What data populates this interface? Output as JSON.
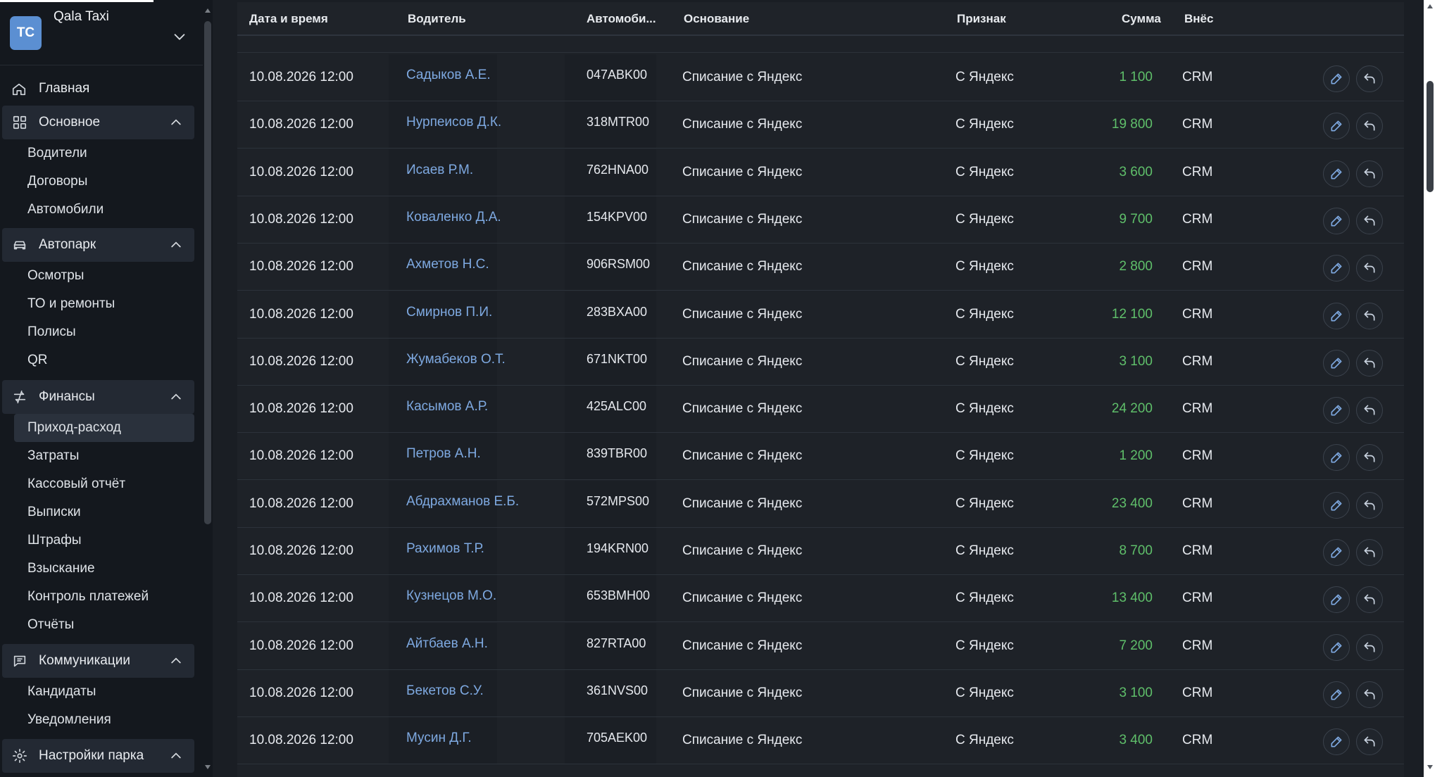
{
  "workspace": {
    "avatar_initials": "TC",
    "name": "Qala Taxi"
  },
  "nav": {
    "home": "Главная",
    "sections": [
      {
        "label": "Основное",
        "items": [
          "Водители",
          "Договоры",
          "Автомобили"
        ]
      },
      {
        "label": "Автопарк",
        "items": [
          "Осмотры",
          "ТО и ремонты",
          "Полисы",
          "QR"
        ]
      },
      {
        "label": "Финансы",
        "items": [
          "Приход-расход",
          "Затраты",
          "Кассовый отчёт",
          "Выписки",
          "Штрафы",
          "Взыскание",
          "Контроль платежей",
          "Отчёты"
        ],
        "active": "Приход-расход"
      },
      {
        "label": "Коммуникации",
        "items": [
          "Кандидаты",
          "Уведомления"
        ]
      },
      {
        "label": "Настройки парка",
        "items": []
      }
    ]
  },
  "table": {
    "columns": [
      "Дата и время",
      "Водитель",
      "Автомоби...",
      "Основание",
      "Признак",
      "Сумма",
      "Внёс"
    ],
    "rows": [
      {
        "datetime": "10.08.2026 12:00",
        "driver": "Садыков А.Е.",
        "car": "047ABK00",
        "reason": "Списание с Яндекс",
        "sign": "С Яндекс",
        "amount": "1 100",
        "by": "CRM"
      },
      {
        "datetime": "10.08.2026 12:00",
        "driver": "Нурпеисов Д.К.",
        "car": "318MTR00",
        "reason": "Списание с Яндекс",
        "sign": "С Яндекс",
        "amount": "19 800",
        "by": "CRM"
      },
      {
        "datetime": "10.08.2026 12:00",
        "driver": "Исаев Р.М.",
        "car": "762HNA00",
        "reason": "Списание с Яндекс",
        "sign": "С Яндекс",
        "amount": "3 600",
        "by": "CRM"
      },
      {
        "datetime": "10.08.2026 12:00",
        "driver": "Коваленко Д.А.",
        "car": "154KPV00",
        "reason": "Списание с Яндекс",
        "sign": "С Яндекс",
        "amount": "9 700",
        "by": "CRM"
      },
      {
        "datetime": "10.08.2026 12:00",
        "driver": "Ахметов Н.С.",
        "car": "906RSM00",
        "reason": "Списание с Яндекс",
        "sign": "С Яндекс",
        "amount": "2 800",
        "by": "CRM"
      },
      {
        "datetime": "10.08.2026 12:00",
        "driver": "Смирнов П.И.",
        "car": "283BXA00",
        "reason": "Списание с Яндекс",
        "sign": "С Яндекс",
        "amount": "12 100",
        "by": "CRM"
      },
      {
        "datetime": "10.08.2026 12:00",
        "driver": "Жумабеков О.Т.",
        "car": "671NKT00",
        "reason": "Списание с Яндекс",
        "sign": "С Яндекс",
        "amount": "3 100",
        "by": "CRM"
      },
      {
        "datetime": "10.08.2026 12:00",
        "driver": "Касымов А.Р.",
        "car": "425ALC00",
        "reason": "Списание с Яндекс",
        "sign": "С Яндекс",
        "amount": "24 200",
        "by": "CRM"
      },
      {
        "datetime": "10.08.2026 12:00",
        "driver": "Петров А.Н.",
        "car": "839TBR00",
        "reason": "Списание с Яндекс",
        "sign": "С Яндекс",
        "amount": "1 200",
        "by": "CRM"
      },
      {
        "datetime": "10.08.2026 12:00",
        "driver": "Абдрахманов Е.Б.",
        "car": "572MPS00",
        "reason": "Списание с Яндекс",
        "sign": "С Яндекс",
        "amount": "23 400",
        "by": "CRM"
      },
      {
        "datetime": "10.08.2026 12:00",
        "driver": "Рахимов Т.Р.",
        "car": "194KRN00",
        "reason": "Списание с Яндекс",
        "sign": "С Яндекс",
        "amount": "8 700",
        "by": "CRM"
      },
      {
        "datetime": "10.08.2026 12:00",
        "driver": "Кузнецов М.О.",
        "car": "653BMH00",
        "reason": "Списание с Яндекс",
        "sign": "С Яндекс",
        "amount": "13 400",
        "by": "CRM"
      },
      {
        "datetime": "10.08.2026 12:00",
        "driver": "Айтбаев А.Н.",
        "car": "827RTA00",
        "reason": "Списание с Яндекс",
        "sign": "С Яндекс",
        "amount": "7 200",
        "by": "CRM"
      },
      {
        "datetime": "10.08.2026 12:00",
        "driver": "Бекетов С.У.",
        "car": "361NVS00",
        "reason": "Списание с Яндекс",
        "sign": "С Яндекс",
        "amount": "3 100",
        "by": "CRM"
      },
      {
        "datetime": "10.08.2026 12:00",
        "driver": "Мусин Д.Г.",
        "car": "705AEK00",
        "reason": "Списание с Яндекс",
        "sign": "С Яндекс",
        "amount": "3 400",
        "by": "CRM"
      }
    ]
  },
  "colors": {
    "accent_link": "#7ea9e1",
    "amount_positive": "#5fbf6a",
    "avatar": "#5b8fd2"
  },
  "icons": {
    "row_actions": [
      "pencil-icon",
      "undo-arrow-icon"
    ]
  }
}
